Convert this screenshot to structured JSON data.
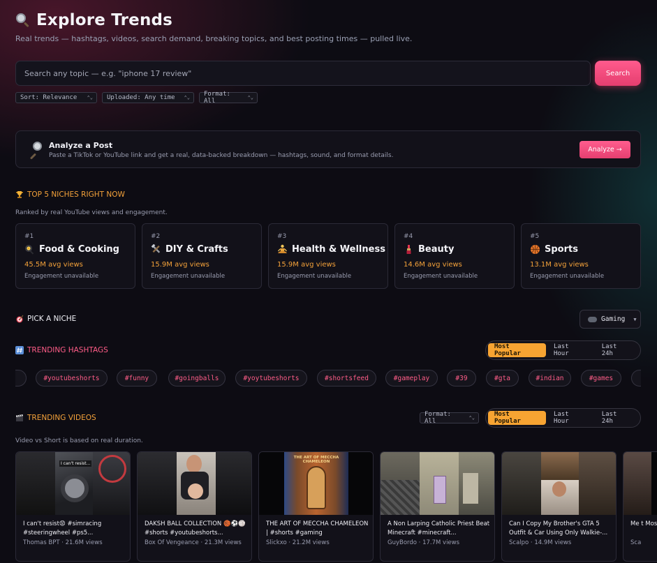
{
  "header": {
    "title": "Explore Trends",
    "subtitle": "Real trends — hashtags, videos, search demand, breaking topics, and best posting times — pulled live."
  },
  "search": {
    "placeholder": "Search any topic — e.g. \"iphone 17 review\"",
    "button": "Search"
  },
  "filters": {
    "sort": "Sort: Relevance",
    "uploaded": "Uploaded: Any time",
    "format": "Format: All"
  },
  "analyze": {
    "heading": "Analyze a Post",
    "description": "Paste a TikTok or YouTube link and get a real, data-backed breakdown — hashtags, sound, and format details.",
    "button": "Analyze →"
  },
  "niches": {
    "heading": "TOP 5 NICHES RIGHT NOW",
    "subheading": "Ranked by real YouTube views and engagement.",
    "items": [
      {
        "rank": "#1",
        "name": "Food & Cooking",
        "avg": "45.5M avg views",
        "engagement": "Engagement unavailable",
        "icon": "frying-pan-icon"
      },
      {
        "rank": "#2",
        "name": "DIY & Crafts",
        "avg": "15.9M avg views",
        "engagement": "Engagement unavailable",
        "icon": "tools-icon"
      },
      {
        "rank": "#3",
        "name": "Health & Wellness",
        "avg": "15.9M avg views",
        "engagement": "Engagement unavailable",
        "icon": "meditation-icon"
      },
      {
        "rank": "#4",
        "name": "Beauty",
        "avg": "14.6M avg views",
        "engagement": "Engagement unavailable",
        "icon": "lipstick-icon"
      },
      {
        "rank": "#5",
        "name": "Sports",
        "avg": "13.1M avg views",
        "engagement": "Engagement unavailable",
        "icon": "basketball-icon"
      }
    ]
  },
  "pick": {
    "heading": "PICK A NICHE",
    "selected": "Gaming"
  },
  "hashtags": {
    "heading": "TRENDING HASHTAGS",
    "tabs": [
      "Most Popular",
      "Last Hour",
      "Last 24h"
    ],
    "active_tab": "Most Popular",
    "items": [
      "#youtubeshorts",
      "#funny",
      "#goingballs",
      "#yoytubeshorts",
      "#shortsfeed",
      "#gameplay",
      "#39",
      "#gta",
      "#indian",
      "#games"
    ]
  },
  "videos": {
    "heading": "TRENDING VIDEOS",
    "format": "Format: All",
    "tabs": [
      "Most Popular",
      "Last Hour",
      "Last 24h"
    ],
    "active_tab": "Most Popular",
    "note": "Video vs Short is based on real duration.",
    "items": [
      {
        "title": "I can't resist😡 #simracing #steeringwheel #ps5...",
        "meta": "Thomas BPT · 21.6M views",
        "thumb_text": "I can't resist..."
      },
      {
        "title": "DAKSH BALL COLLECTION 🏀⚽🏐 #shorts #youtubeshorts...",
        "meta": "Box Of Vengeance · 21.3M views"
      },
      {
        "title": "THE ART OF MECCHA CHAMELEON | #shorts #gaming",
        "meta": "Slickxo · 21.2M views",
        "thumb_text": "THE ART OF MECCHA CHAMELEON"
      },
      {
        "title": "A Non Larping Catholic Priest Beat Minecraft #minecraft...",
        "meta": "GuyBordo · 17.7M views"
      },
      {
        "title": "Can I Copy My Brother's GTA 5 Outfit & Car Using Only Walkie-...",
        "meta": "Scalpo · 14.9M views"
      },
      {
        "title": "Me t Mos",
        "meta": "Sca"
      }
    ]
  },
  "colors": {
    "accent_pink": "#ff5d88",
    "accent_orange": "#f7a432",
    "background": "#0d0c13"
  }
}
